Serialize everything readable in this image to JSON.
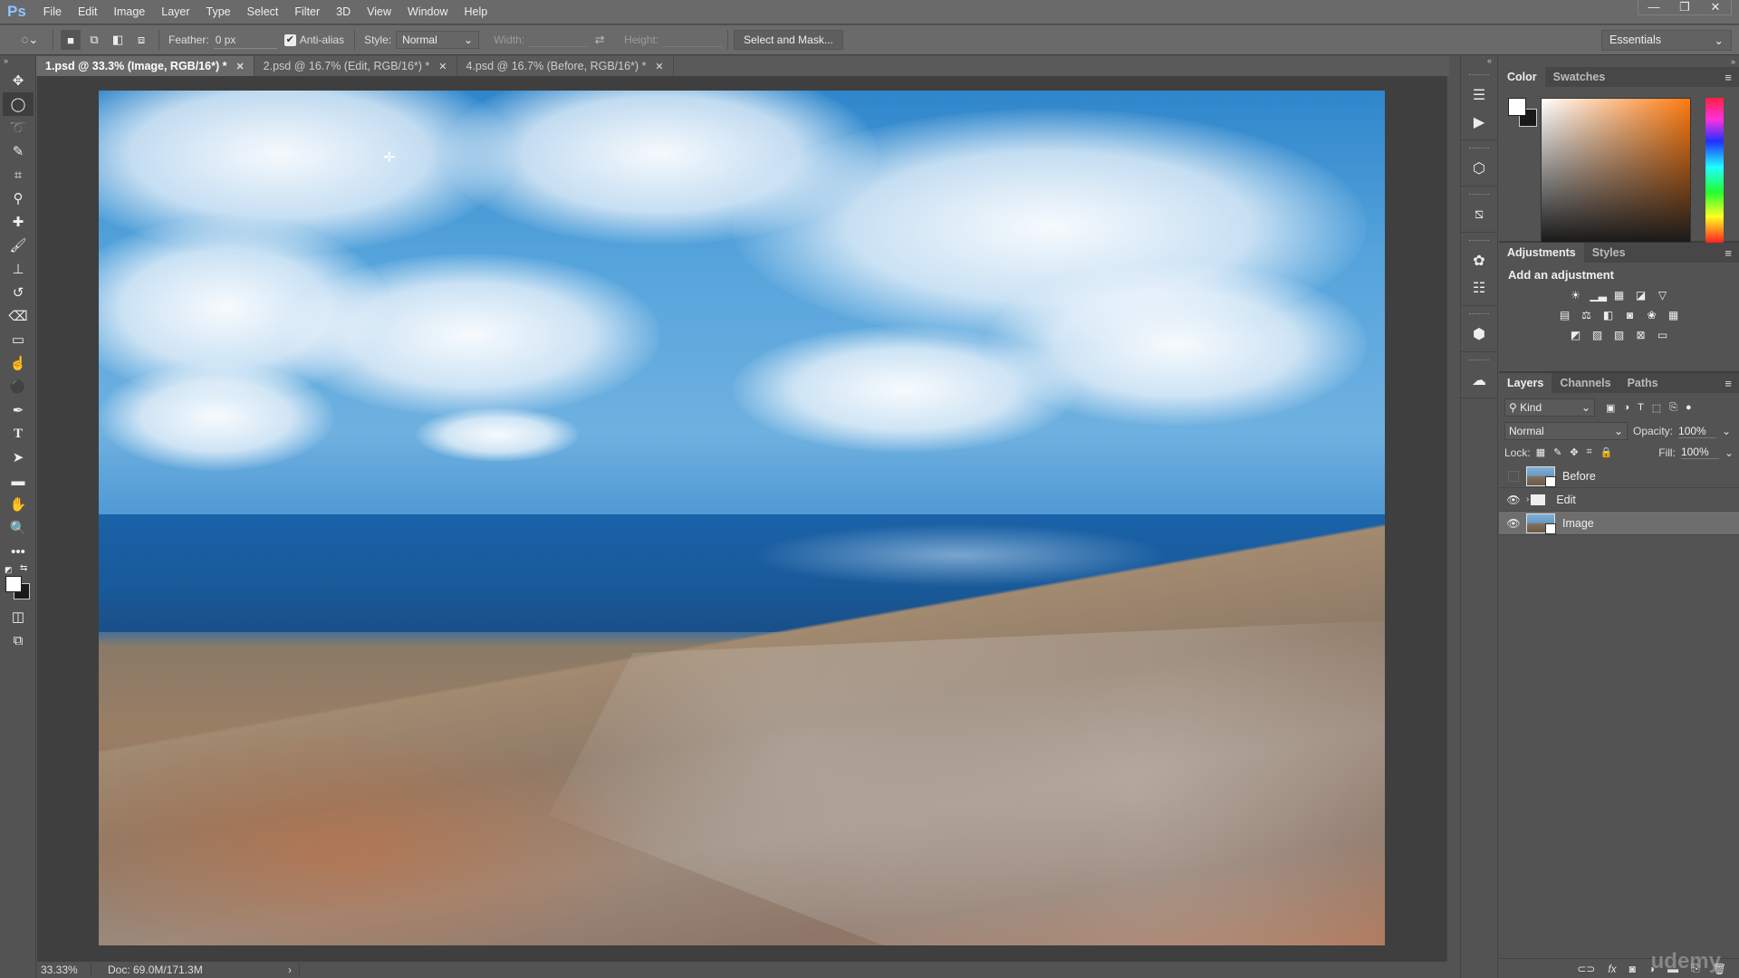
{
  "app": {
    "logo": "Ps"
  },
  "menu": [
    "File",
    "Edit",
    "Image",
    "Layer",
    "Type",
    "Select",
    "Filter",
    "3D",
    "View",
    "Window",
    "Help"
  ],
  "window_controls": {
    "minimize": "—",
    "restore": "❐",
    "close": "✕"
  },
  "options": {
    "feather_label": "Feather:",
    "feather_value": "0 px",
    "antialias_label": "Anti-alias",
    "antialias_checked": true,
    "style_label": "Style:",
    "style_value": "Normal",
    "width_label": "Width:",
    "height_label": "Height:",
    "select_mask_label": "Select and Mask...",
    "workspace": "Essentials"
  },
  "tabs": [
    {
      "label": "1.psd @ 33.3% (Image, RGB/16*) *",
      "active": true
    },
    {
      "label": "2.psd @ 16.7% (Edit, RGB/16*) *",
      "active": false
    },
    {
      "label": "4.psd @ 16.7% (Before, RGB/16*) *",
      "active": false
    }
  ],
  "tools": [
    "move-tool",
    "elliptical-marquee-tool",
    "lasso-tool",
    "quick-selection-tool",
    "crop-tool",
    "eyedropper-tool",
    "spot-healing-tool",
    "brush-tool",
    "clone-stamp-tool",
    "history-brush-tool",
    "eraser-tool",
    "gradient-tool",
    "smudge-tool",
    "dodge-tool",
    "pen-tool",
    "type-tool",
    "path-selection-tool",
    "rectangle-tool",
    "hand-tool",
    "zoom-tool",
    "more-tools"
  ],
  "status": {
    "zoom": "33.33%",
    "doc": "Doc: 69.0M/171.3M",
    "arrow": "›"
  },
  "color_panel": {
    "tabs": [
      "Color",
      "Swatches"
    ],
    "fg": "#ffffff",
    "bg": "#1a1a1a"
  },
  "adjustments_panel": {
    "tabs": [
      "Adjustments",
      "Styles"
    ],
    "title": "Add an adjustment"
  },
  "layers_panel": {
    "tabs": [
      "Layers",
      "Channels",
      "Paths"
    ],
    "kind_label": "Kind",
    "blend_mode": "Normal",
    "opacity_label": "Opacity:",
    "opacity_value": "100%",
    "lock_label": "Lock:",
    "fill_label": "Fill:",
    "fill_value": "100%",
    "layers": [
      {
        "name": "Before",
        "visible": false,
        "type": "smart-object",
        "selected": false
      },
      {
        "name": "Edit",
        "visible": true,
        "type": "group",
        "selected": false
      },
      {
        "name": "Image",
        "visible": true,
        "type": "smart-object",
        "selected": true
      }
    ]
  },
  "watermark": "udemy"
}
